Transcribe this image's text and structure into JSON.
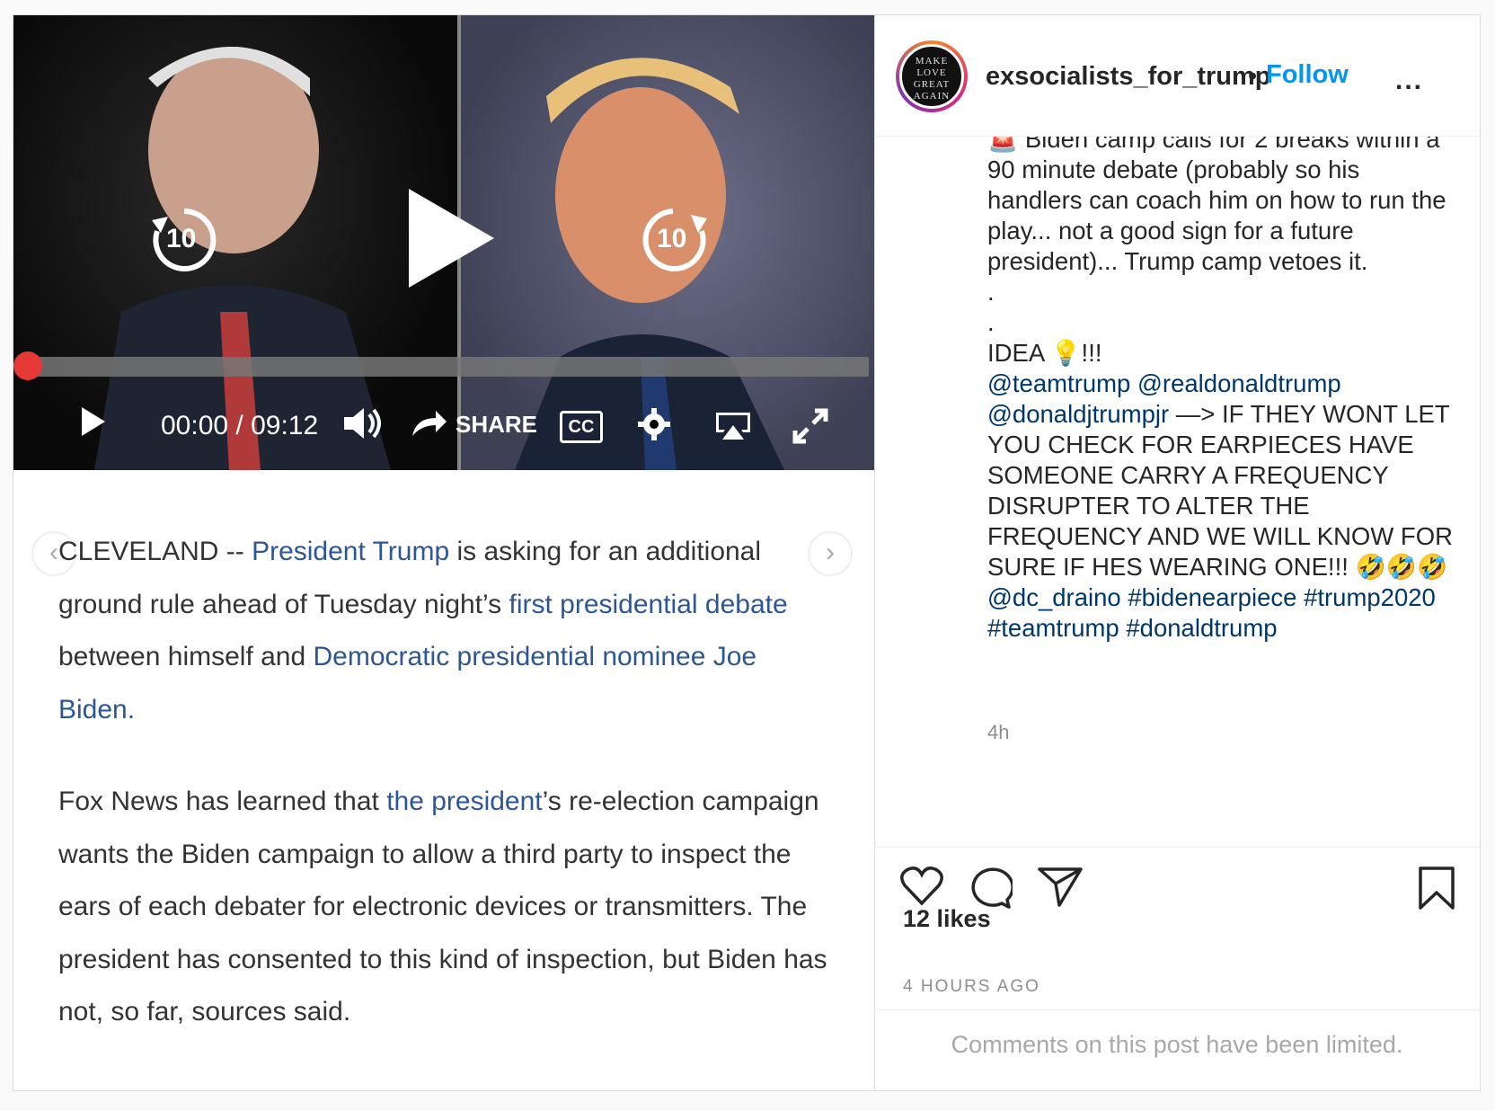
{
  "post": {
    "username": "exsocialists_for_trump",
    "separator": "•",
    "follow_label": "Follow",
    "more_label": "...",
    "avatar_text": "MAKE LOVE GREAT AGAIN"
  },
  "video": {
    "time": "00:00 / 09:12",
    "share_label": "SHARE",
    "cc_label": "CC",
    "rewind_seconds": "10",
    "forward_seconds": "10",
    "progress": 0.0
  },
  "article": {
    "p1": {
      "t1": "CLEVELAND -- ",
      "l1": "President Trump",
      "t2": " is asking for an additional ground rule ahead of Tuesday night’s ",
      "l2": "first presidential debate",
      "t3": " between himself and ",
      "l3": "Democratic presidential nominee Joe Biden."
    },
    "p2": {
      "t1": "Fox News has learned that ",
      "l1": "the president",
      "t2": "’s re-election campaign wants the Biden campaign to allow a third party to inspect the ears of each debater for electronic devices or transmitters. The president has consented to this kind of inspection, but Biden has not, so far, sources said."
    }
  },
  "caption": {
    "line1": "🚨 Biden camp calls for 2 breaks within a 90 minute debate (probably so his handlers can coach him on how to run the play... not a good sign for a future president)... Trump camp vetoes it.",
    "dot1": ".",
    "dot2": ".",
    "idea": "IDEA 💡!!!",
    "mention1": "@teamtrump",
    "mention2": "@realdonaldtrump",
    "mention3": "@donaldjtrumpjr",
    "body": " —> IF THEY WONT LET YOU CHECK FOR EARPIECES HAVE SOMEONE CARRY A FREQUENCY DISRUPTER TO ALTER THE FREQUENCY AND WE WILL KNOW FOR SURE IF HES WEARING ONE!!! 🤣🤣🤣 ",
    "mention4": "@dc_draino",
    "tag1": "#bidenearpiece",
    "tag2": "#trump2020",
    "tag3": "#teamtrump",
    "tag4": "#donaldtrump",
    "time_ago": "4h"
  },
  "actions": {
    "likes": "12 likes",
    "posted": "4 HOURS AGO",
    "comments_limited": "Comments on this post have been limited."
  },
  "colors": {
    "link": "#2d5696",
    "follow": "#0095f6",
    "progress": "#e53935"
  }
}
